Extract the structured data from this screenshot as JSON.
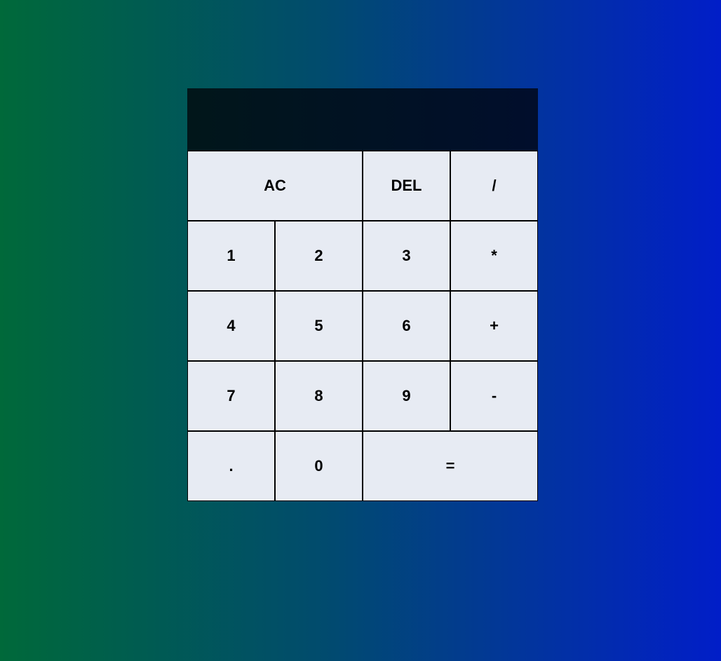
{
  "display": {
    "previous_operand": "",
    "current_operand": ""
  },
  "keys": {
    "all_clear": "AC",
    "delete": "DEL",
    "divide": "/",
    "one": "1",
    "two": "2",
    "three": "3",
    "multiply": "*",
    "four": "4",
    "five": "5",
    "six": "6",
    "add": "+",
    "seven": "7",
    "eight": "8",
    "nine": "9",
    "subtract": "-",
    "decimal": ".",
    "zero": "0",
    "equals": "="
  },
  "colors": {
    "background_left": "#00693a",
    "background_right": "#011ec8",
    "display_background": "#010f22",
    "key_background": "#e7ebf3",
    "key_border": "#000000"
  }
}
